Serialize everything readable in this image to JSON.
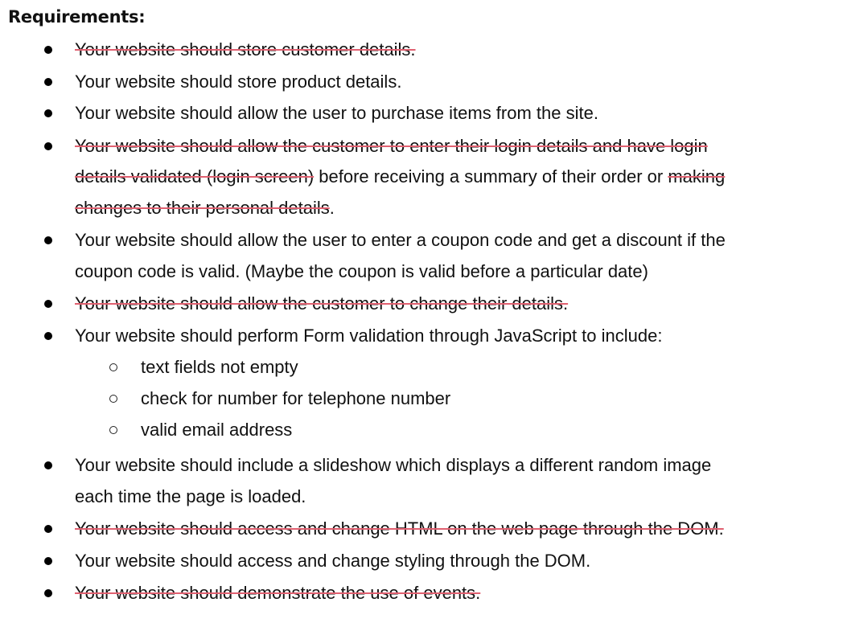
{
  "heading": "Requirements:",
  "items": [
    {
      "text": "Your website should store customer details."
    },
    {
      "text": "Your website should store product details."
    },
    {
      "text": "Your website should allow the user to purchase items from the site."
    },
    {
      "line1": "Your website should allow the customer to enter their login details and have login",
      "line2_strike": "details validated (login screen)",
      "line2_plain": " before receiving a summary of their order or ",
      "line2_strike_end": "making",
      "line3_strike": "changes to their personal details",
      "line3_plain": "."
    },
    {
      "line1": "Your website should allow the user to enter a coupon code and get a discount if the",
      "line2": "coupon code is valid. (Maybe the coupon is valid before a particular date)"
    },
    {
      "text": "Your website should allow the customer to change their details."
    },
    {
      "text": "Your website should perform Form validation through JavaScript to include:"
    },
    {
      "text": "Your website should include a slideshow which displays a different random image",
      "line2": "each time the page is loaded."
    },
    {
      "text": "Your website should access and change HTML on the web page through the DOM."
    },
    {
      "text": "Your website should access and change styling through the DOM."
    },
    {
      "text": "Your website should demonstrate the use of events."
    }
  ],
  "subitems": [
    "text fields not empty",
    "check for number for telephone number",
    "valid email address"
  ]
}
